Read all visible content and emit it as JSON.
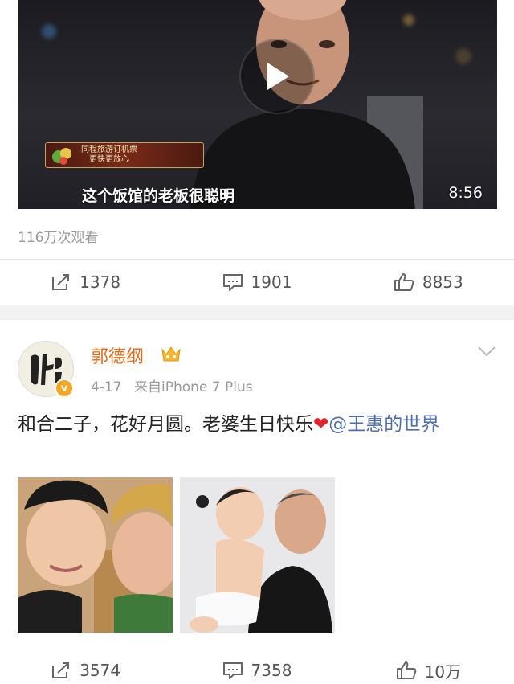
{
  "post1": {
    "video": {
      "caption": "这个饭馆的老板很聪明",
      "duration": "8:56",
      "banner_line1": "同程旅游订机票",
      "banner_line2": "更快更放心"
    },
    "views": "116万次观看",
    "actions": {
      "repost": "1378",
      "comment": "1901",
      "like": "8853"
    }
  },
  "post2": {
    "author": "郭德纲",
    "verified_badge": "v",
    "date": "4-17",
    "source": "来自iPhone 7 Plus",
    "text": "和合二子，花好月圆。老婆生日快乐",
    "heart": "❤",
    "mention": "@王惠的世界",
    "actions": {
      "repost": "3574",
      "comment": "7358",
      "like": "10万"
    }
  },
  "colors": {
    "username": "#e86b1a",
    "mention": "#4e6ea8",
    "heart": "#e0242d",
    "verified": "#f5a623"
  }
}
